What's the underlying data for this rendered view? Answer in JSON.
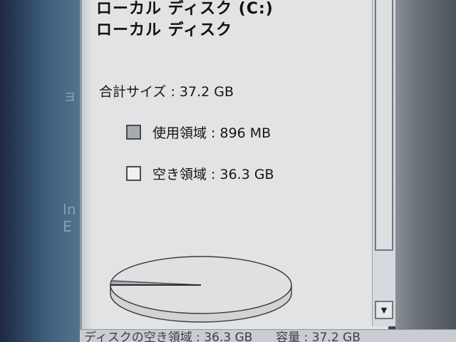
{
  "drive": {
    "name": "ローカル ディスク (C:)",
    "type": "ローカル ディスク"
  },
  "capacity": {
    "total_label": "合計サイズ : 37.2 GB",
    "used_label": "使用領域 : 896 MB",
    "free_label": "空き領域 : 36.3 GB",
    "used_fraction": 0.024
  },
  "colors": {
    "used_swatch": "#a7aab0",
    "free_swatch": "#f0f0f0"
  },
  "statusbar": {
    "free_text": "ディスクの空き領域 : 36.3 GB",
    "capacity_text": "容量 : 37.2 GB"
  },
  "desktop": {
    "fragment_1": "ョ",
    "fragment_2": "In",
    "fragment_3": "E"
  },
  "icons": {
    "scroll_down": "scroll-down-arrow-icon"
  }
}
